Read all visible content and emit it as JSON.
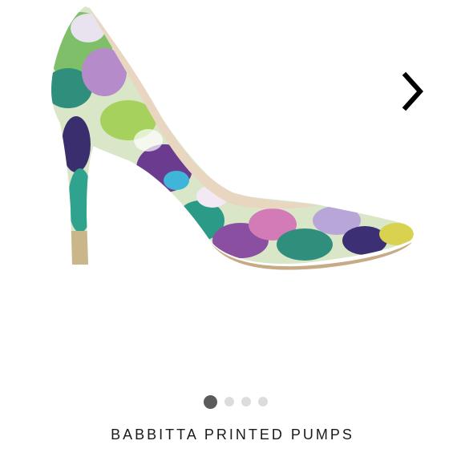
{
  "product": {
    "title": "BABBITTA PRINTED PUMPS",
    "image_icon": "shoe-image"
  },
  "carousel": {
    "next_icon": "chevron-right-icon",
    "slides": [
      {
        "label": "slide-1",
        "active": true
      },
      {
        "label": "slide-2",
        "active": false
      },
      {
        "label": "slide-3",
        "active": false
      },
      {
        "label": "slide-4",
        "active": false
      }
    ]
  },
  "colors": {
    "active_dot": "#5b5b5b",
    "inactive_dot": "#dcdcdc",
    "title_text": "#1a1a1a",
    "background": "#ffffff"
  }
}
